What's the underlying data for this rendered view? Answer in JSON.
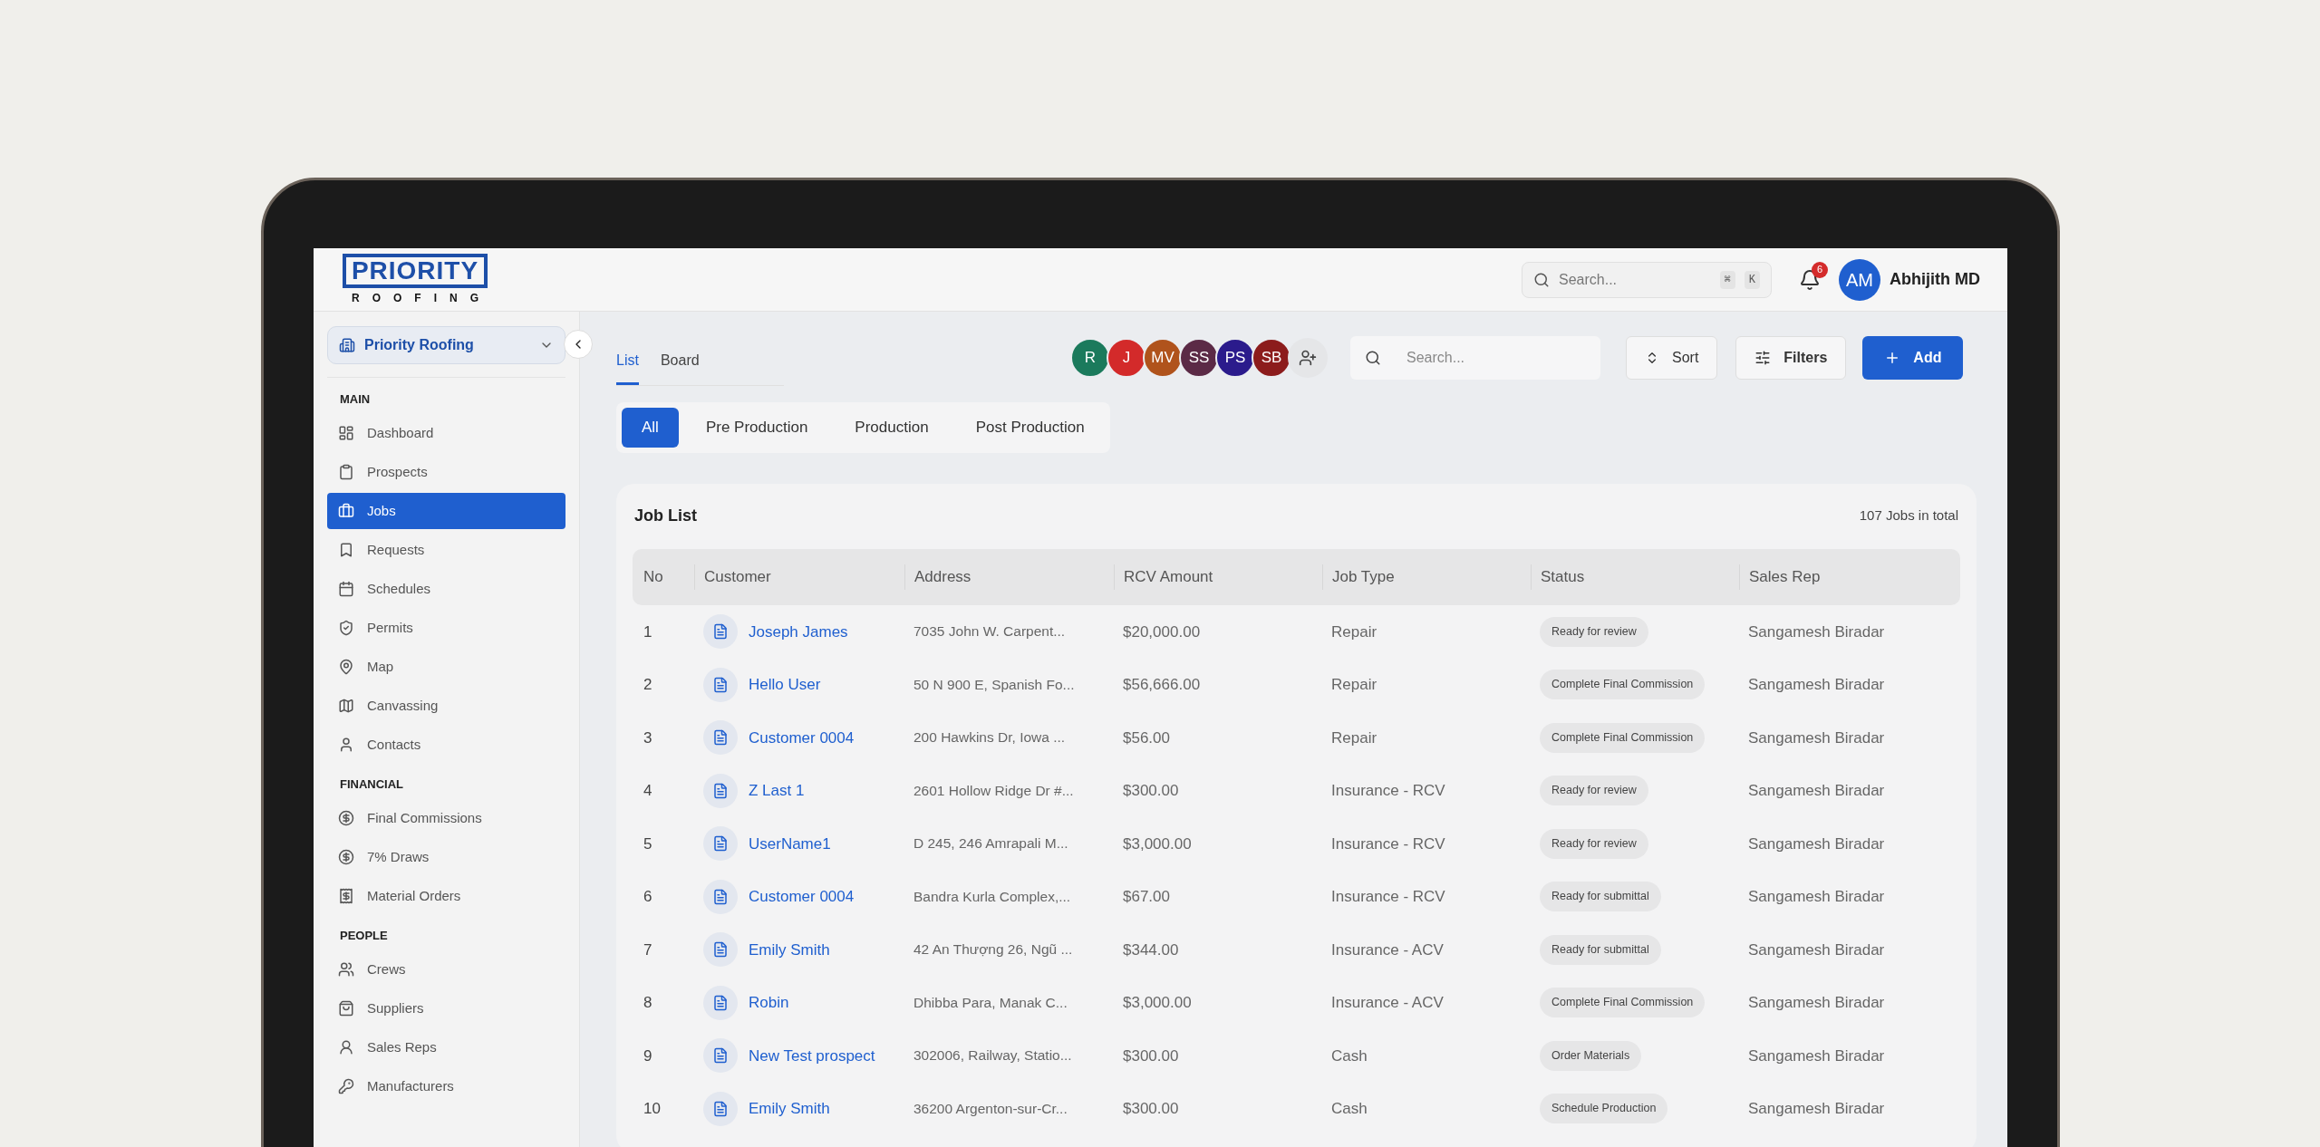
{
  "logo": {
    "top": "PRIORITY",
    "bottom": "ROOFING"
  },
  "header": {
    "search": {
      "placeholder": "Search..."
    },
    "shortcut": [
      "⌘",
      "K"
    ],
    "notifications": "6",
    "user": {
      "initials": "AM",
      "name": "Abhijith MD"
    }
  },
  "sidebar": {
    "company": "Priority Roofing",
    "sections": [
      {
        "title": "MAIN",
        "items": [
          {
            "label": "Dashboard",
            "selected": false
          },
          {
            "label": "Prospects",
            "selected": false
          },
          {
            "label": "Jobs",
            "selected": true
          },
          {
            "label": "Requests",
            "selected": false
          },
          {
            "label": "Schedules",
            "selected": false
          },
          {
            "label": "Permits",
            "selected": false
          },
          {
            "label": "Map",
            "selected": false
          },
          {
            "label": "Canvassing",
            "selected": false
          },
          {
            "label": "Contacts",
            "selected": false
          }
        ]
      },
      {
        "title": "FINANCIAL",
        "items": [
          {
            "label": "Final Commissions",
            "selected": false
          },
          {
            "label": "7% Draws",
            "selected": false
          },
          {
            "label": "Material Orders",
            "selected": false
          }
        ]
      },
      {
        "title": "PEOPLE",
        "items": [
          {
            "label": "Crews",
            "selected": false
          },
          {
            "label": "Suppliers",
            "selected": false
          },
          {
            "label": "Sales Reps",
            "selected": false
          },
          {
            "label": "Manufacturers",
            "selected": false
          }
        ]
      }
    ]
  },
  "view_tabs": [
    {
      "label": "List",
      "selected": true
    },
    {
      "label": "Board",
      "selected": false
    }
  ],
  "assignees": [
    {
      "initials": "R",
      "color": "#1b7a5c"
    },
    {
      "initials": "J",
      "color": "#d32a2a"
    },
    {
      "initials": "MV",
      "color": "#b0531c"
    },
    {
      "initials": "SS",
      "color": "#5b2a46"
    },
    {
      "initials": "PS",
      "color": "#2b1b8c"
    },
    {
      "initials": "SB",
      "color": "#8c1c1c"
    }
  ],
  "search": {
    "placeholder": "Search..."
  },
  "buttons": {
    "sort": "Sort",
    "filters": "Filters",
    "add": "Add"
  },
  "stage_tabs": [
    {
      "label": "All",
      "selected": true
    },
    {
      "label": "Pre Production",
      "selected": false
    },
    {
      "label": "Production",
      "selected": false
    },
    {
      "label": "Post Production",
      "selected": false
    }
  ],
  "table": {
    "title": "Job List",
    "total": "107 Jobs in total",
    "columns": [
      "No",
      "Customer",
      "Address",
      "RCV Amount",
      "Job Type",
      "Status",
      "Sales Rep"
    ],
    "rows": [
      {
        "no": "1",
        "customer": "Joseph James",
        "address": "7035 John W. Carpent...",
        "amount": "$20,000.00",
        "job_type": "Repair",
        "status": "Ready for review",
        "sales_rep": "Sangamesh Biradar"
      },
      {
        "no": "2",
        "customer": "Hello User",
        "address": "50 N 900 E, Spanish Fo...",
        "amount": "$56,666.00",
        "job_type": "Repair",
        "status": "Complete Final Commission",
        "sales_rep": "Sangamesh Biradar"
      },
      {
        "no": "3",
        "customer": "Customer 0004",
        "address": "200 Hawkins Dr, Iowa ...",
        "amount": "$56.00",
        "job_type": "Repair",
        "status": "Complete Final Commission",
        "sales_rep": "Sangamesh Biradar"
      },
      {
        "no": "4",
        "customer": "Z Last 1",
        "address": "2601 Hollow Ridge Dr #...",
        "amount": "$300.00",
        "job_type": "Insurance - RCV",
        "status": "Ready for review",
        "sales_rep": "Sangamesh Biradar"
      },
      {
        "no": "5",
        "customer": "UserName1",
        "address": "D 245, 246 Amrapali M...",
        "amount": "$3,000.00",
        "job_type": "Insurance - RCV",
        "status": "Ready for review",
        "sales_rep": "Sangamesh Biradar"
      },
      {
        "no": "6",
        "customer": "Customer 0004",
        "address": "Bandra Kurla Complex,...",
        "amount": "$67.00",
        "job_type": "Insurance - RCV",
        "status": "Ready for submittal",
        "sales_rep": "Sangamesh Biradar"
      },
      {
        "no": "7",
        "customer": "Emily Smith",
        "address": "42 An Thượng 26, Ngũ ...",
        "amount": "$344.00",
        "job_type": "Insurance - ACV",
        "status": "Ready for submittal",
        "sales_rep": "Sangamesh Biradar"
      },
      {
        "no": "8",
        "customer": "Robin",
        "address": "Dhibba Para, Manak C...",
        "amount": "$3,000.00",
        "job_type": "Insurance - ACV",
        "status": "Complete Final Commission",
        "sales_rep": "Sangamesh Biradar"
      },
      {
        "no": "9",
        "customer": "New Test prospect",
        "address": "302006, Railway, Statio...",
        "amount": "$300.00",
        "job_type": "Cash",
        "status": "Order Materials",
        "sales_rep": "Sangamesh Biradar"
      },
      {
        "no": "10",
        "customer": "Emily Smith",
        "address": "36200 Argenton-sur-Cr...",
        "amount": "$300.00",
        "job_type": "Cash",
        "status": "Schedule Production",
        "sales_rep": "Sangamesh Biradar"
      }
    ]
  }
}
